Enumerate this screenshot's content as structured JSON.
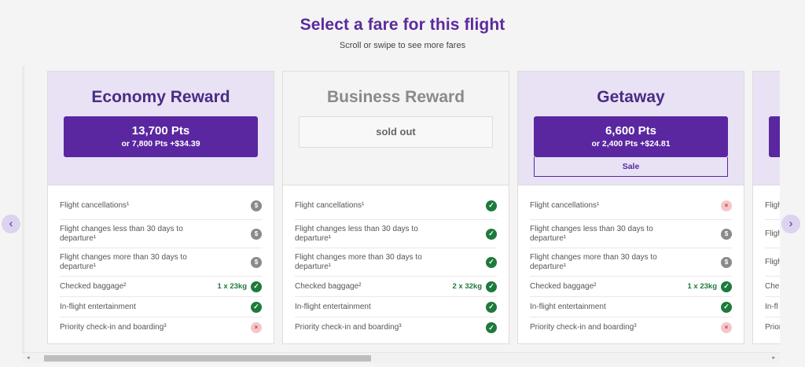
{
  "heading": {
    "title": "Select a fare for this flight",
    "subtitle": "Scroll or swipe to see more fares"
  },
  "nav": {
    "prev": "‹",
    "next": "›"
  },
  "fares": [
    {
      "name": "Economy Reward",
      "points": "13,700 Pts",
      "alt": "or 7,800 Pts +$34.39",
      "features": [
        {
          "label": "Flight cancellations¹",
          "icon": "dollar-icon",
          "allowance": ""
        },
        {
          "label": "Flight changes less than 30 days to departure¹",
          "icon": "dollar-icon",
          "allowance": ""
        },
        {
          "label": "Flight changes more than 30 days to departure¹",
          "icon": "dollar-icon",
          "allowance": ""
        },
        {
          "label": "Checked baggage²",
          "icon": "check-icon",
          "allowance": "1 x 23kg"
        },
        {
          "label": "In-flight entertainment",
          "icon": "check-icon",
          "allowance": ""
        },
        {
          "label": "Priority check-in and boarding³",
          "icon": "cross-icon",
          "allowance": ""
        }
      ]
    },
    {
      "name": "Business Reward",
      "status": "sold out",
      "features": [
        {
          "label": "Flight cancellations¹",
          "icon": "check-icon",
          "allowance": ""
        },
        {
          "label": "Flight changes less than 30 days to departure¹",
          "icon": "check-icon",
          "allowance": ""
        },
        {
          "label": "Flight changes more than 30 days to departure¹",
          "icon": "check-icon",
          "allowance": ""
        },
        {
          "label": "Checked baggage²",
          "icon": "check-icon",
          "allowance": "2 x 32kg"
        },
        {
          "label": "In-flight entertainment",
          "icon": "check-icon",
          "allowance": ""
        },
        {
          "label": "Priority check-in and boarding³",
          "icon": "check-icon",
          "allowance": ""
        }
      ]
    },
    {
      "name": "Getaway",
      "points": "6,600 Pts",
      "alt": "or 2,400 Pts +$24.81",
      "badge": "Sale",
      "features": [
        {
          "label": "Flight cancellations¹",
          "icon": "cross-icon",
          "allowance": ""
        },
        {
          "label": "Flight changes less than 30 days to departure¹",
          "icon": "dollar-icon",
          "allowance": ""
        },
        {
          "label": "Flight changes more than 30 days to departure¹",
          "icon": "dollar-icon",
          "allowance": ""
        },
        {
          "label": "Checked baggage²",
          "icon": "check-icon",
          "allowance": "1 x 23kg"
        },
        {
          "label": "In-flight entertainment",
          "icon": "check-icon",
          "allowance": ""
        },
        {
          "label": "Priority check-in and boarding³",
          "icon": "cross-icon",
          "allowance": ""
        }
      ]
    },
    {
      "partial_labels": [
        "Fligh",
        "Fligh",
        "Fligh",
        "Che",
        "In-fl",
        "Prior"
      ]
    }
  ],
  "icons": {
    "check": "✓",
    "dollar": "$",
    "cross": "×"
  },
  "scrollbar": {
    "left": "◂",
    "right": "▸"
  },
  "colors": {
    "accent": "#5a27a0",
    "title": "#4a2b85",
    "panel": "#e8e2f4",
    "included": "#1e7a3c",
    "fee": "#8a8a8a",
    "excluded": "#f4c7cc"
  }
}
